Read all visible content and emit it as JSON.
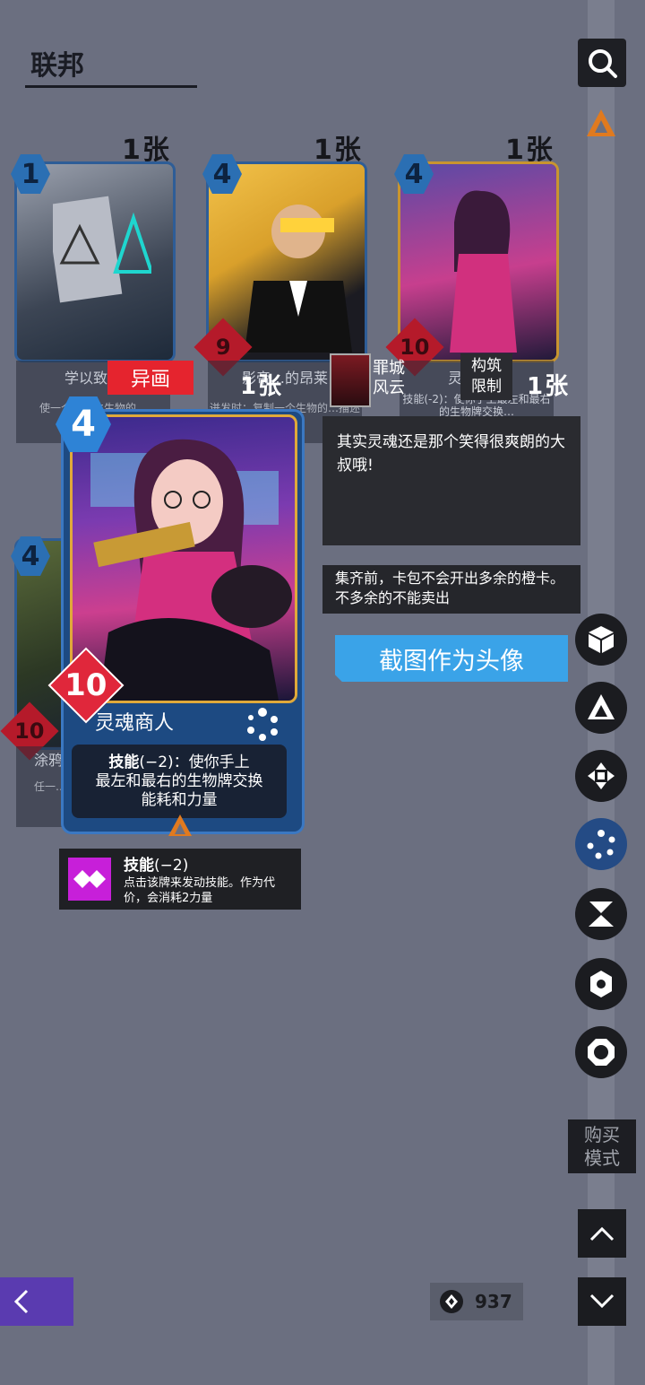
{
  "header": {
    "title": "联邦"
  },
  "grid": {
    "cards": [
      {
        "cost": "1",
        "power": "",
        "name": "学以致用",
        "desc": "使一个…对位生物的…",
        "count": "1张"
      },
      {
        "cost": "4",
        "power": "9",
        "name": "影帝…的昂莱",
        "desc": "迸发时：复制一个生物的…描述",
        "count": "1张"
      },
      {
        "cost": "4",
        "power": "10",
        "name": "灵魂商人",
        "desc": "技能(-2)：使你手上最左和最右的生物牌交换…",
        "count": "1张"
      },
      {
        "cost": "4",
        "power": "10",
        "name": "涂鸦…",
        "desc": "任一…将一…",
        "count": ""
      }
    ],
    "alt_art_badge": "异画"
  },
  "related": {
    "card_count": "1张",
    "sin_city_label": "罪城\n风云",
    "build_limit_label": "构筑\n限制",
    "build_limit_count": "1张"
  },
  "detail": {
    "cost": "4",
    "power": "10",
    "name": "灵魂商人",
    "skill_keyword": "技能",
    "skill_text": "(−2)：使你手上\n最左和最右的生物牌交换\n能耗和力量"
  },
  "keyword_tip": {
    "title_keyword": "技能",
    "title_rest": "(−2)",
    "body": "点击该牌来发动技能。作为代价，会消耗2力量"
  },
  "flavor_text": "其实灵魂还是那个笑得很爽朗的大叔哦!",
  "note_text": "集齐前，卡包不会开出多余的橙卡。不多余的不能卖出",
  "cta_button": "截图作为头像",
  "sidebar": {
    "buy_mode": "购买\n模式"
  },
  "currency": {
    "amount": "937"
  },
  "colors": {
    "accent_blue": "#3aa3e8",
    "rarity_orange": "#e07a1f",
    "cost_blue": "#2b6fb3",
    "power_red": "#b51a2a"
  }
}
